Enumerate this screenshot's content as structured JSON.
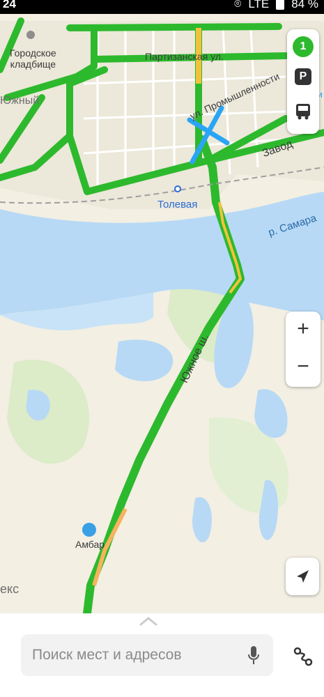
{
  "status_bar": {
    "time": "24",
    "network": "LTE",
    "battery": "84 %"
  },
  "map": {
    "labels": {
      "cemetery": "Городское\nкладбище",
      "partizanskaya": "Партизанская ул.",
      "zavod": "Завод",
      "promyshlennosti": "ул. Промышленности",
      "tolevaya": "Толевая",
      "river": "р. Самара",
      "yuzhnoe_sh": "Южное ш.",
      "ambar": "Амбар",
      "yuzhny": "Южный",
      "yandex_partial": "екс",
      "ki_partial": "Ки"
    }
  },
  "controls": {
    "traffic_level": "1",
    "parking_label": "P",
    "zoom_in": "+",
    "zoom_out": "−"
  },
  "search": {
    "placeholder": "Поиск мест и адресов"
  },
  "colors": {
    "traffic_green": "#2db92d",
    "water": "#b7d9f5",
    "accent_blue": "#2aa5f5",
    "road": "#f3c23c"
  }
}
